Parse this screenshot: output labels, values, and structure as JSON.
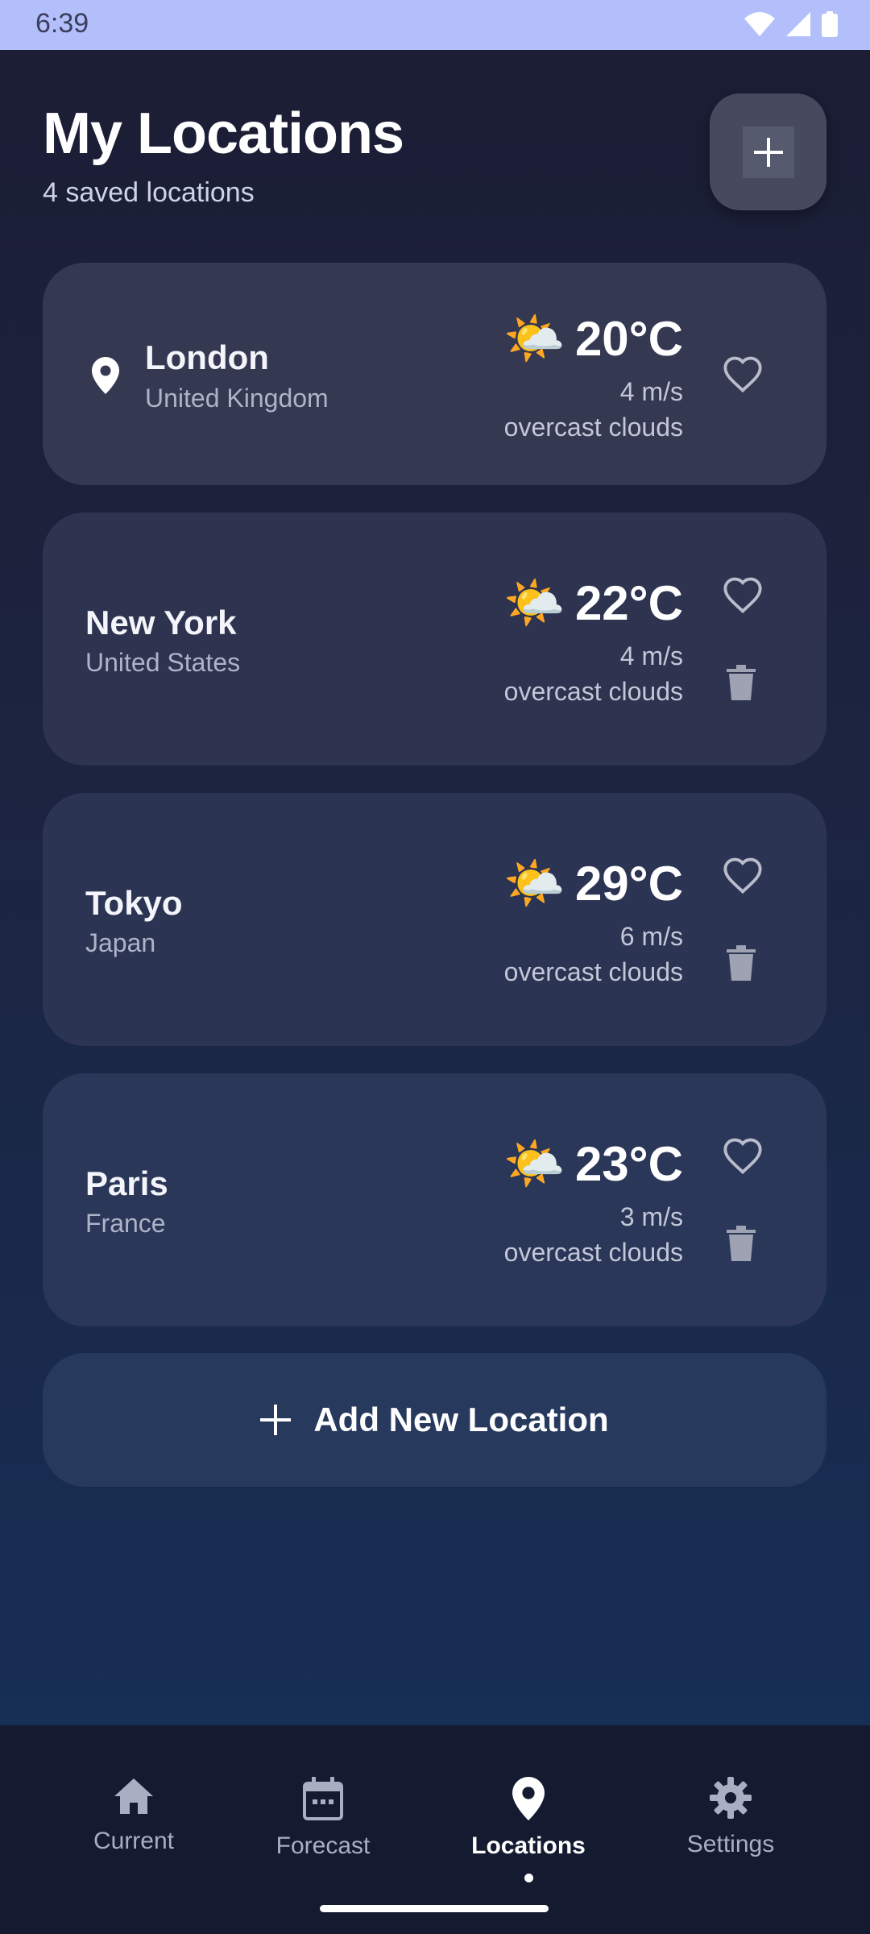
{
  "status_bar": {
    "time": "6:39"
  },
  "header": {
    "title": "My Locations",
    "subtitle": "4 saved locations"
  },
  "locations": [
    {
      "name": "London",
      "country": "United Kingdom",
      "temp": "20°C",
      "wind": "4 m/s",
      "description": "overcast clouds",
      "selected": true,
      "icon": "sun-cloud-icon"
    },
    {
      "name": "New York",
      "country": "United States",
      "temp": "22°C",
      "wind": "4 m/s",
      "description": "overcast clouds",
      "selected": false,
      "icon": "sun-cloud-icon"
    },
    {
      "name": "Tokyo",
      "country": "Japan",
      "temp": "29°C",
      "wind": "6 m/s",
      "description": "overcast clouds",
      "selected": false,
      "icon": "sun-cloud-icon"
    },
    {
      "name": "Paris",
      "country": "France",
      "temp": "23°C",
      "wind": "3 m/s",
      "description": "overcast clouds",
      "selected": false,
      "icon": "sun-cloud-icon"
    }
  ],
  "add_location": {
    "label": "Add New Location"
  },
  "weather_emoji": "🌤️",
  "nav": {
    "items": [
      {
        "label": "Current",
        "icon": "home-icon"
      },
      {
        "label": "Forecast",
        "icon": "calendar-icon"
      },
      {
        "label": "Locations",
        "icon": "location-pin-icon",
        "active": true
      },
      {
        "label": "Settings",
        "icon": "gear-icon"
      }
    ]
  },
  "colors": {
    "status_bar": "#b3bffa",
    "card": "#353851",
    "nav_bg": "#141a30"
  }
}
